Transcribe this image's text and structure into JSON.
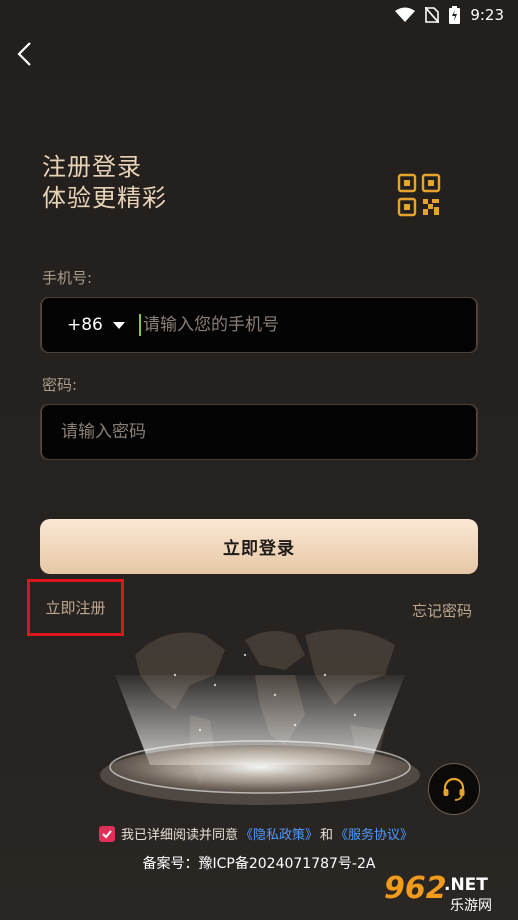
{
  "status_bar": {
    "time": "9:23"
  },
  "headline": {
    "line1": "注册登录",
    "line2": "体验更精彩"
  },
  "phone": {
    "label": "手机号:",
    "country_code": "+86",
    "placeholder": "请输入您的手机号",
    "value": ""
  },
  "password": {
    "label": "密码:",
    "placeholder": "请输入密码",
    "value": ""
  },
  "login_button": "立即登录",
  "register_link": "立即注册",
  "forgot_link": "忘记密码",
  "agreement": {
    "checked": true,
    "text": "我已详细阅读并同意",
    "privacy_link": "《隐私政策》",
    "and": "和",
    "service_link": "《服务协议》"
  },
  "icp": "备案号：豫ICP备2024071787号-2A",
  "watermark": {
    "text1": "962",
    "text2": ".NET",
    "text3": "乐游网"
  },
  "colors": {
    "accent_gold": "#e6a52a",
    "button_gradient": "#f3d9be",
    "link_blue": "#4f9bff",
    "checkbox": "#e0305a",
    "highlight_box": "#e0141c"
  },
  "icons": [
    "wifi-icon",
    "no-sim-icon",
    "battery-icon",
    "back-arrow-icon",
    "qr-code-icon",
    "dropdown-caret-icon",
    "headset-icon",
    "check-icon"
  ]
}
